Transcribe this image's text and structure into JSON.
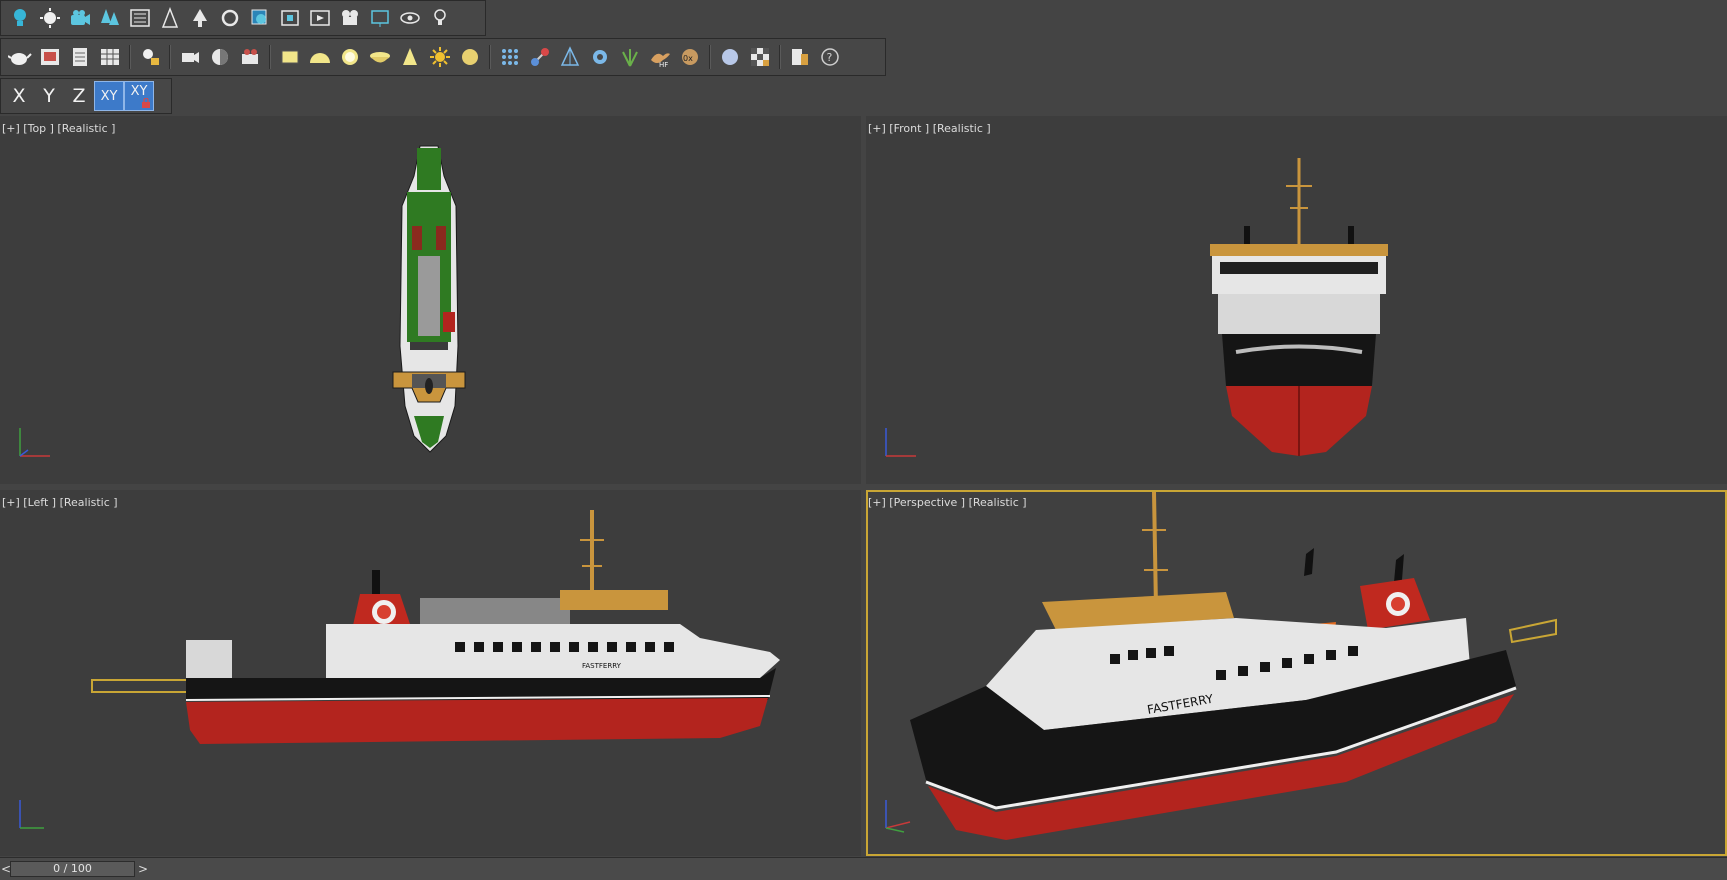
{
  "toolbar_main": {
    "icons": [
      "light-icon",
      "sun-icon",
      "camera-group-icon",
      "trees-icon",
      "list-icon",
      "material-icon",
      "tree-icon",
      "rotate-icon",
      "layers-icon",
      "frame-icon",
      "render-icon",
      "camera-icon",
      "monitor-icon",
      "eye-icon",
      "bulb-icon"
    ]
  },
  "toolbar_create": {
    "icons": [
      "teapot-icon",
      "image-icon",
      "notes-icon",
      "grid-icon",
      "lamp-icon",
      "camera-rig-icon",
      "shader-icon",
      "video-icon",
      "plane-icon",
      "dome-icon",
      "ring-icon",
      "bowl-icon",
      "cone-icon",
      "starburst-icon",
      "sphere-icon",
      "dots-icon",
      "molecule-icon",
      "pyramid-icon",
      "gear-icon",
      "grass-icon",
      "bird-icon",
      "shell-icon",
      "globe-icon",
      "checker-icon",
      "doc-icon",
      "help-icon"
    ],
    "hf_label": "HF",
    "ox_label": "0x"
  },
  "axis_constraints": {
    "x_label": "X",
    "y_label": "Y",
    "z_label": "Z",
    "xy_label": "XY",
    "xy_lock_label": "XY",
    "active": "XY"
  },
  "viewports": {
    "top": {
      "label": "[+] [Top ] [Realistic ]"
    },
    "front": {
      "label": "[+] [Front ] [Realistic ]"
    },
    "left": {
      "label": "[+] [Left ] [Realistic ]"
    },
    "perspective": {
      "label": "[+] [Perspective ] [Realistic ]"
    }
  },
  "timeline": {
    "frame_label": "0 / 100",
    "prev_label": "<",
    "next_label": ">"
  },
  "ship": {
    "name_text": "FASTFERRY"
  },
  "colors": {
    "accent_blue": "#3d7ac9",
    "active_border": "#c9a635",
    "hull_red": "#b3241e",
    "hull_black": "#151515",
    "deck_green": "#2f7a22",
    "mast_orange": "#c9953d"
  }
}
